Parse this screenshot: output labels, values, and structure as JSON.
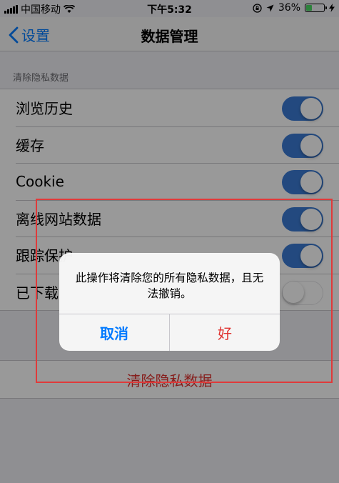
{
  "status_bar": {
    "carrier": "中国移动",
    "time": "下午5:32",
    "battery_percent": "36%",
    "battery_level": 0.36,
    "icons": [
      "signal-icon",
      "wifi-icon",
      "rotation-lock-icon",
      "location-icon",
      "battery-icon",
      "charging-icon"
    ]
  },
  "nav": {
    "back_label": "设置",
    "title": "数据管理"
  },
  "section": {
    "header": "清除隐私数据",
    "items": [
      {
        "label": "浏览历史",
        "toggle": "on"
      },
      {
        "label": "缓存",
        "toggle": "on"
      },
      {
        "label": "Cookie",
        "toggle": "on"
      },
      {
        "label": "离线网站数据",
        "toggle": "on"
      },
      {
        "label": "跟踪保护",
        "toggle": "on"
      },
      {
        "label": "已下载",
        "toggle": "off"
      }
    ]
  },
  "action": {
    "label": "清除隐私数据",
    "color": "#e0322f"
  },
  "alert": {
    "message_line1": "此操作将清除您的所有隐私数据，且无",
    "message_line2": "法撤销。",
    "cancel_label": "取消",
    "ok_label": "好"
  },
  "colors": {
    "accent": "#007aff",
    "toggle_on": "#3b7bd4",
    "destructive": "#e0322f",
    "highlight_box": "#e03a3a"
  }
}
